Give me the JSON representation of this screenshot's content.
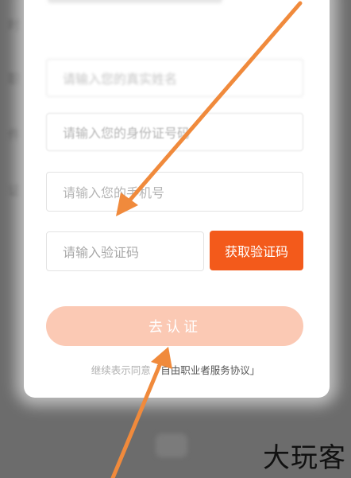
{
  "background": {
    "left_chars": [
      "时",
      "职",
      "件",
      "证"
    ]
  },
  "form": {
    "name_placeholder": "请输入您的真实姓名",
    "id_placeholder": "请输入您的身份证号码",
    "phone_placeholder": "请输入您的手机号",
    "code_placeholder": "请输入验证码",
    "get_code_label": "获取验证码",
    "submit_label": "去认证",
    "agreement_prefix": "继续表示同意",
    "agreement_link": "「自由职业者服务协议」"
  },
  "watermark": {
    "text": "大玩客"
  },
  "colors": {
    "accent": "#f35a1b",
    "submit_disabled": "#fbc9b4",
    "annotation_arrow": "#f08a3c"
  }
}
